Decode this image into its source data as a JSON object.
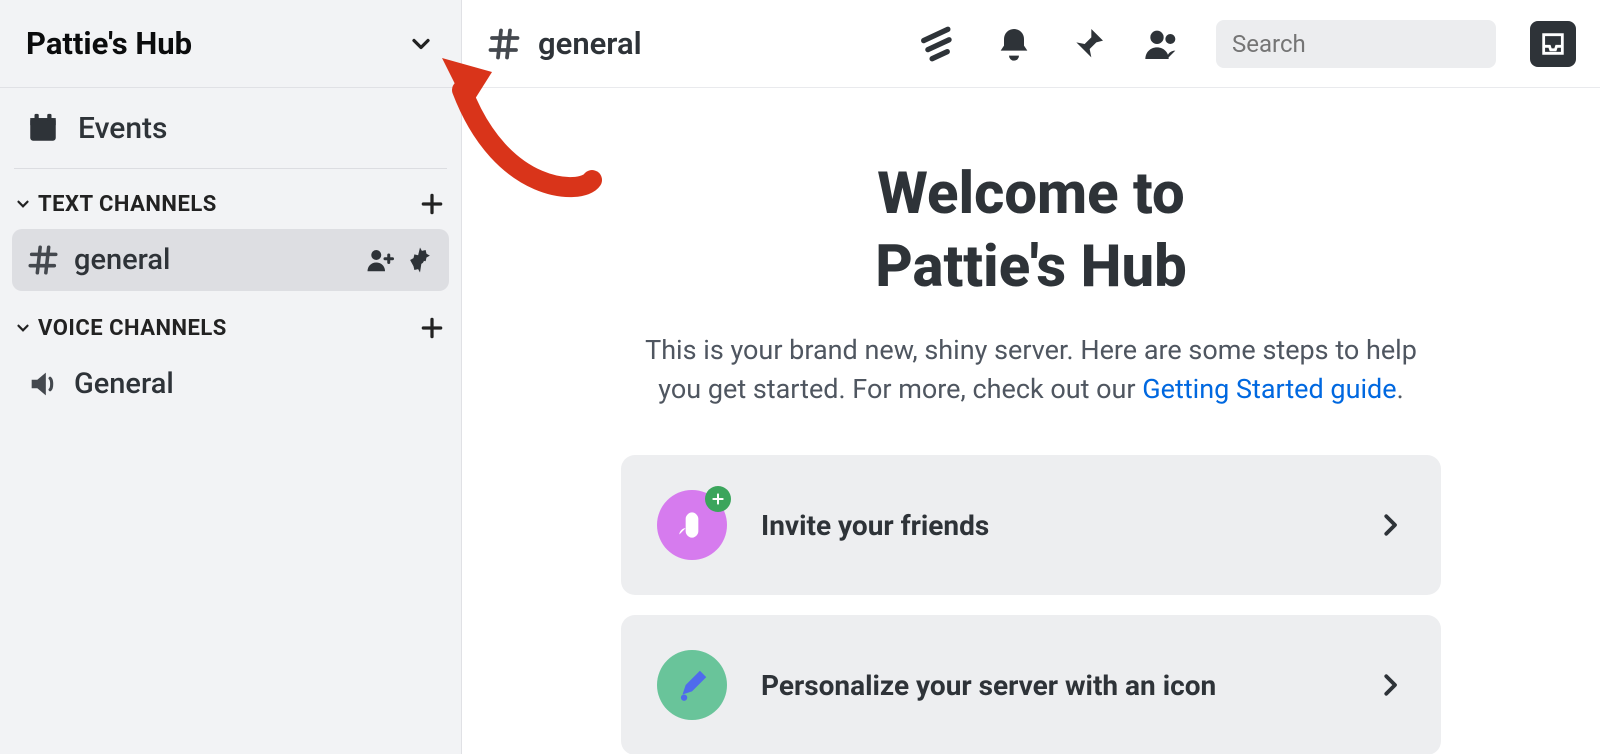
{
  "server": {
    "name": "Pattie's Hub"
  },
  "sidebar": {
    "events_label": "Events",
    "sections": [
      {
        "title": "TEXT CHANNELS",
        "channels": [
          {
            "name": "general",
            "active": true,
            "type": "text"
          }
        ]
      },
      {
        "title": "VOICE CHANNELS",
        "channels": [
          {
            "name": "General",
            "active": false,
            "type": "voice"
          }
        ]
      }
    ]
  },
  "topbar": {
    "channel_name": "general",
    "search_placeholder": "Search"
  },
  "welcome": {
    "title_line1": "Welcome to",
    "title_line2": "Pattie's Hub",
    "subtitle_prefix": "This is your brand new, shiny server. Here are some steps to help you get started. For more, check out our ",
    "subtitle_link": "Getting Started guide",
    "subtitle_suffix": "."
  },
  "cards": [
    {
      "label": "Invite your friends",
      "icon": "wave",
      "color": "pink",
      "badge": true
    },
    {
      "label": "Personalize your server with an icon",
      "icon": "brush",
      "color": "teal",
      "badge": false
    }
  ]
}
